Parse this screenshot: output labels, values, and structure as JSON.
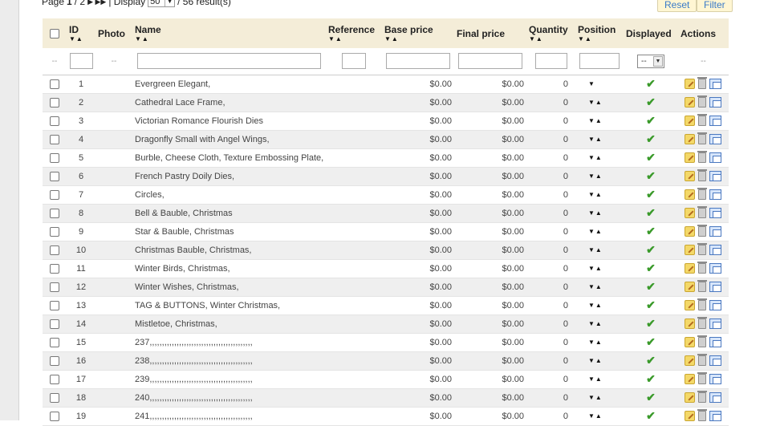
{
  "pager": {
    "page_label": "Page",
    "current_page": "1",
    "of": "/ 2",
    "nav": "▶ ▶▶",
    "display_label": "| Display",
    "per_page": "50",
    "total": "/ 56 result(s)"
  },
  "buttons": {
    "reset": "Reset",
    "filter": "Filter"
  },
  "columns": {
    "id": "ID",
    "photo": "Photo",
    "name": "Name",
    "reference": "Reference",
    "base_price": "Base price",
    "final_price": "Final price",
    "quantity": "Quantity",
    "position": "Position",
    "displayed": "Displayed",
    "actions": "Actions"
  },
  "filter_row": {
    "dash": "--",
    "displayed_select": "--"
  },
  "sort_arrows": {
    "both": "▼▲",
    "position_down": "▼"
  },
  "check_glyph": "✔",
  "products": [
    {
      "id": "1",
      "name": "Evergreen Elegant,",
      "base": "$0.00",
      "final": "$0.00",
      "qty": "0",
      "pos": "▼"
    },
    {
      "id": "2",
      "name": "Cathedral Lace Frame,",
      "base": "$0.00",
      "final": "$0.00",
      "qty": "0",
      "pos": "▼▲"
    },
    {
      "id": "3",
      "name": "Victorian Romance Flourish Dies",
      "base": "$0.00",
      "final": "$0.00",
      "qty": "0",
      "pos": "▼▲"
    },
    {
      "id": "4",
      "name": "Dragonfly Small with Angel Wings,",
      "base": "$0.00",
      "final": "$0.00",
      "qty": "0",
      "pos": "▼▲"
    },
    {
      "id": "5",
      "name": "Burble, Cheese Cloth, Texture Embossing Plate,",
      "base": "$0.00",
      "final": "$0.00",
      "qty": "0",
      "pos": "▼▲"
    },
    {
      "id": "6",
      "name": "French Pastry Doily Dies,",
      "base": "$0.00",
      "final": "$0.00",
      "qty": "0",
      "pos": "▼▲"
    },
    {
      "id": "7",
      "name": "Circles,",
      "base": "$0.00",
      "final": "$0.00",
      "qty": "0",
      "pos": "▼▲"
    },
    {
      "id": "8",
      "name": "Bell & Bauble, Christmas",
      "base": "$0.00",
      "final": "$0.00",
      "qty": "0",
      "pos": "▼▲"
    },
    {
      "id": "9",
      "name": "Star & Bauble, Christmas",
      "base": "$0.00",
      "final": "$0.00",
      "qty": "0",
      "pos": "▼▲"
    },
    {
      "id": "10",
      "name": "Christmas Bauble, Christmas,",
      "base": "$0.00",
      "final": "$0.00",
      "qty": "0",
      "pos": "▼▲"
    },
    {
      "id": "11",
      "name": "Winter Birds, Christmas,",
      "base": "$0.00",
      "final": "$0.00",
      "qty": "0",
      "pos": "▼▲"
    },
    {
      "id": "12",
      "name": "Winter Wishes, Christmas,",
      "base": "$0.00",
      "final": "$0.00",
      "qty": "0",
      "pos": "▼▲"
    },
    {
      "id": "13",
      "name": "TAG & BUTTONS, Winter Christmas,",
      "base": "$0.00",
      "final": "$0.00",
      "qty": "0",
      "pos": "▼▲"
    },
    {
      "id": "14",
      "name": "Mistletoe, Christmas,",
      "base": "$0.00",
      "final": "$0.00",
      "qty": "0",
      "pos": "▼▲"
    },
    {
      "id": "15",
      "name": "237,,,,,,,,,,,,,,,,,,,,,,,,,,,,,,,,,,,,,,,,,,",
      "base": "$0.00",
      "final": "$0.00",
      "qty": "0",
      "pos": "▼▲"
    },
    {
      "id": "16",
      "name": "238,,,,,,,,,,,,,,,,,,,,,,,,,,,,,,,,,,,,,,,,,,",
      "base": "$0.00",
      "final": "$0.00",
      "qty": "0",
      "pos": "▼▲"
    },
    {
      "id": "17",
      "name": "239,,,,,,,,,,,,,,,,,,,,,,,,,,,,,,,,,,,,,,,,,,",
      "base": "$0.00",
      "final": "$0.00",
      "qty": "0",
      "pos": "▼▲"
    },
    {
      "id": "18",
      "name": "240,,,,,,,,,,,,,,,,,,,,,,,,,,,,,,,,,,,,,,,,,,",
      "base": "$0.00",
      "final": "$0.00",
      "qty": "0",
      "pos": "▼▲"
    },
    {
      "id": "19",
      "name": "241,,,,,,,,,,,,,,,,,,,,,,,,,,,,,,,,,,,,,,,,,,",
      "base": "$0.00",
      "final": "$0.00",
      "qty": "0",
      "pos": "▼▲"
    }
  ],
  "colors": {
    "header_bg": "#f4edd8",
    "name_link": "#8a4b12",
    "alt_row": "#efefef",
    "check": "#3a9a2a",
    "button_text": "#3a7bc8"
  }
}
